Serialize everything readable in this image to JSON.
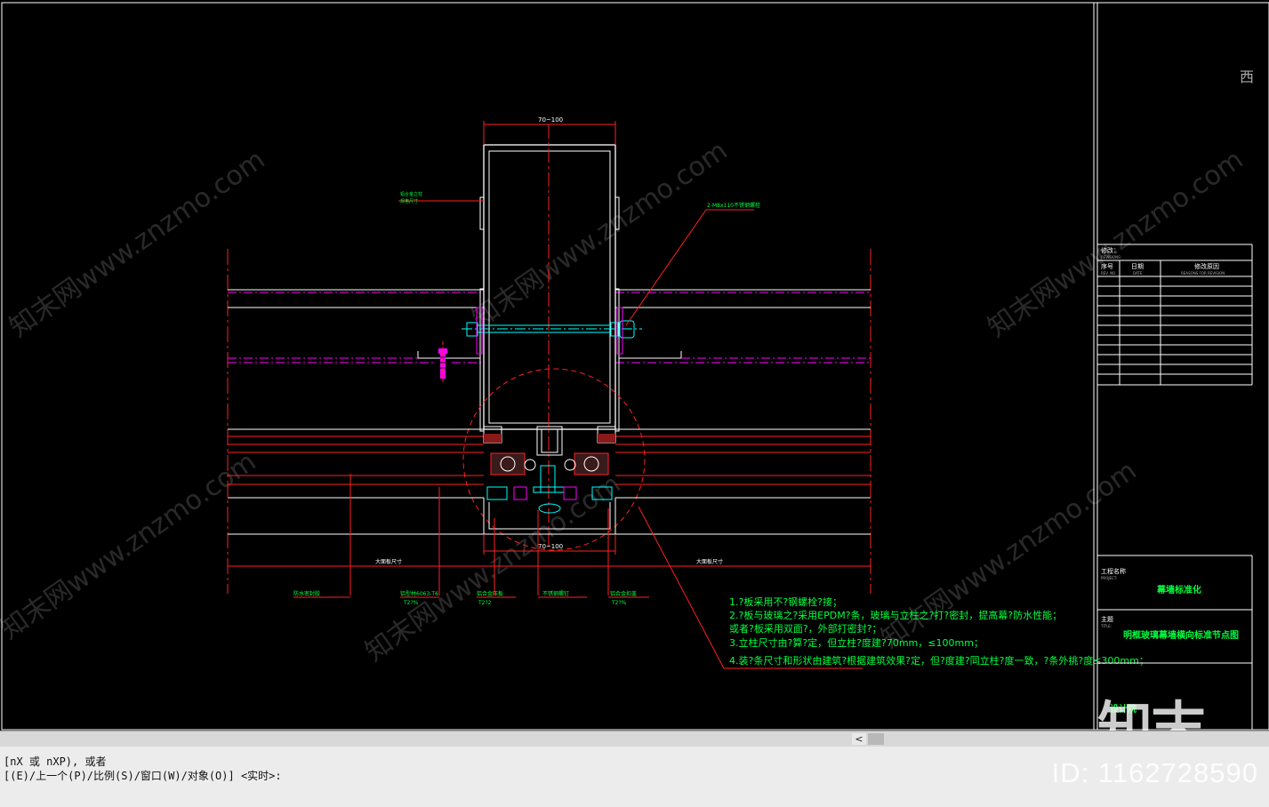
{
  "drawing": {
    "dim_top": "70~100",
    "dim_bottom": "70~100",
    "callout_top_left": [
      "铝合金立柱",
      "规格尺寸"
    ],
    "callout_bolt": "2-M8x110不锈钢螺栓",
    "dim_left_span": "大面板尺寸",
    "dim_right_span": "大面板尺寸",
    "labels_bottom": [
      {
        "text": "防水密封胶",
        "sub": ""
      },
      {
        "text": "铝型材6063-T6",
        "sub": "T2?%"
      },
      {
        "text": "铝合金压板",
        "sub": "T2?2"
      },
      {
        "text": "不锈钢螺钉",
        "sub": ""
      },
      {
        "text": "铝合金扣盖",
        "sub": "T2?%"
      }
    ],
    "notes": [
      "1.?板采用不?钢螺栓?接；",
      "2.?板与玻璃之?采用EPDM?条，玻璃与立柱之?打?密封，提高幕?防水性能；",
      "   或者?板采用双面?，外部打密封?；",
      "3.立柱尺寸由?算?定，但立柱?度建?70mm，≤100mm；",
      "4.装?条尺寸和形状由建筑?根据建筑效果?定，但?度建?同立柱?度一致，?条外挑?度≤300mm；"
    ]
  },
  "title_block": {
    "revisions_title": "修改：",
    "revisions_sub": "REVISIONS:",
    "col_no": "序号",
    "col_no_sub": "REV. NO.",
    "col_date": "日期",
    "col_date_sub": "DATE",
    "col_reason": "修改原因",
    "col_reason_sub": "REASONS FOR REVISION",
    "project_label": "工程名称",
    "project_sub": "PROJECT:",
    "project_name": "幕墙标准化",
    "title_label": "主题",
    "title_sub": "TITLE:",
    "title_name": "明框玻璃幕墙横向标准节点图",
    "footer_name": "设计院",
    "corner_char": "西"
  },
  "watermarks": {
    "diag": "知末网www.znzmo.com",
    "id": "ID: 1162728590",
    "logo": "知末"
  },
  "command_line": {
    "line1": "[nX 或 nXP), 或者",
    "line2": "[(E)/上一个(P)/比例(S)/窗口(W)/对象(O)] <实时>:"
  },
  "scroll": {
    "left_arrow": "<"
  },
  "colors": {
    "bg": "#000000",
    "white": "#ffffff",
    "red": "#ff2020",
    "magenta": "#ff00ff",
    "cyan": "#00ffff",
    "green": "#00ff40",
    "yellow": "#ffff00"
  }
}
